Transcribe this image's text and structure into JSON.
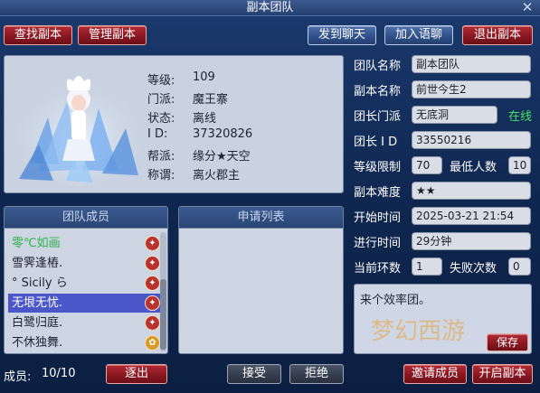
{
  "window": {
    "title": "副本团队",
    "close_glyph": "✕"
  },
  "toolbar": {
    "find_label": "查找副本",
    "manage_label": "管理副本",
    "send_chat_label": "发到聊天",
    "join_voice_label": "加入语聊",
    "exit_label": "退出副本"
  },
  "profile": {
    "level_label": "等级:",
    "level": "109",
    "school_label": "门派:",
    "school": "魔王寨",
    "status_label": "状态:",
    "status": "离线",
    "id_label": "I D:",
    "id": "37320826",
    "guild_label": "帮派:",
    "guild": "缘分★天空",
    "title_label": "称谓:",
    "title": "离火郡主"
  },
  "team": {
    "name_label": "团队名称",
    "name": "副本团队",
    "dungeon_label": "副本名称",
    "dungeon": "前世今生2",
    "leader_school_label": "团长门派",
    "leader_school": "无底洞",
    "leader_online": "在线",
    "leader_id_label": "团长 I D",
    "leader_id": "33550216",
    "level_limit_label": "等级限制",
    "level_limit": "70",
    "min_people_label": "最低人数",
    "min_people": "10",
    "difficulty_label": "副本难度",
    "difficulty": "★★",
    "start_time_label": "开始时间",
    "start_time": "2025-03-21 21:54",
    "elapsed_label": "进行时间",
    "elapsed": "29分钟",
    "round_label": "当前环数",
    "round": "1",
    "fail_label": "失败次数",
    "fail": "0",
    "note": "来个效率团。",
    "save_label": "保存"
  },
  "members": {
    "header": "团队成员",
    "items": [
      {
        "name": "零℃如画"
      },
      {
        "name": "雪霁逢樁."
      },
      {
        "name": "° Sicily ら"
      },
      {
        "name": "无垠无忧."
      },
      {
        "name": "白鹭归庭."
      },
      {
        "name": "不休独舞."
      }
    ]
  },
  "applications": {
    "header": "申请列表"
  },
  "footer": {
    "count_label": "成员:",
    "count": "10/10",
    "kick_label": "逐出",
    "accept_label": "接受",
    "reject_label": "拒绝",
    "invite_label": "邀请成员",
    "start_label": "开启副本"
  },
  "colors": {
    "online": "#48e060",
    "member_highlight": "#2fb24a",
    "selected_row": "#4b56c8"
  }
}
